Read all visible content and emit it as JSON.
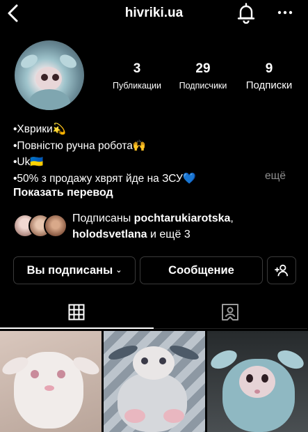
{
  "header": {
    "username": "hivriki.ua",
    "icons": [
      "back-arrow-icon",
      "bell-icon",
      "more-icon"
    ]
  },
  "stats": [
    {
      "value": "3",
      "label": "Публикации"
    },
    {
      "value": "29",
      "label": "Подписчики"
    },
    {
      "value": "9",
      "label": "Подписки"
    }
  ],
  "bio": {
    "lines": [
      "•Хврики💫",
      "•Повністю ручна робота🙌",
      "•Uk🇺🇦",
      "•50% з продажу хврят йде на ЗСУ💙"
    ],
    "more": "ещё",
    "translate": "Показать перевод"
  },
  "followed_by": {
    "prefix": "Подписаны ",
    "user1": "pochtarukiarotska",
    "separator": ",",
    "user2": "holodsvetlana",
    "suffix": " и ещё 3"
  },
  "actions": {
    "following_label": "Вы подписаны",
    "message_label": "Сообщение"
  },
  "tabs": [
    "grid-icon",
    "tagged-icon"
  ],
  "colors": {
    "background": "#000000",
    "text": "#ffffff",
    "muted": "#8e8e8e",
    "button_border": "#3a3a3a",
    "heart": "#3897f0"
  }
}
